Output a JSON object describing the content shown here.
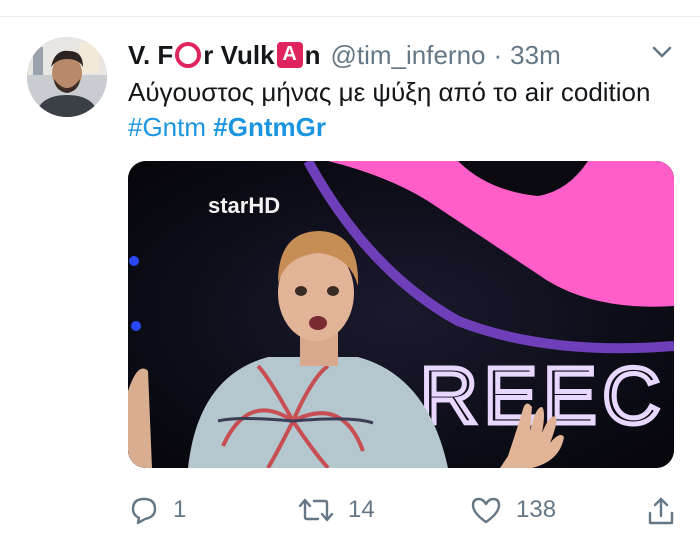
{
  "tweet": {
    "author": {
      "name_part1": "V. F",
      "name_part2": "r Vulk",
      "name_part3": "n",
      "name_emoji_a": "A",
      "handle": "@tim_inferno",
      "separator": "·",
      "time": "33m"
    },
    "text": "Αύγουστος μήνας με ψύξη από το air codition",
    "hashtags": [
      "#Gntm",
      "#GntmGr"
    ],
    "media": {
      "channel_logo": "starHD",
      "background_text": "REEC"
    },
    "actions": {
      "reply_count": "1",
      "retweet_count": "14",
      "like_count": "138"
    }
  },
  "icons": {
    "menu": "chevron-down-icon",
    "reply": "reply-icon",
    "retweet": "retweet-icon",
    "like": "heart-icon",
    "share": "share-icon"
  },
  "colors": {
    "link": "#1b95e0",
    "secondary_text": "#657786",
    "emoji_red": "#e0245e"
  }
}
